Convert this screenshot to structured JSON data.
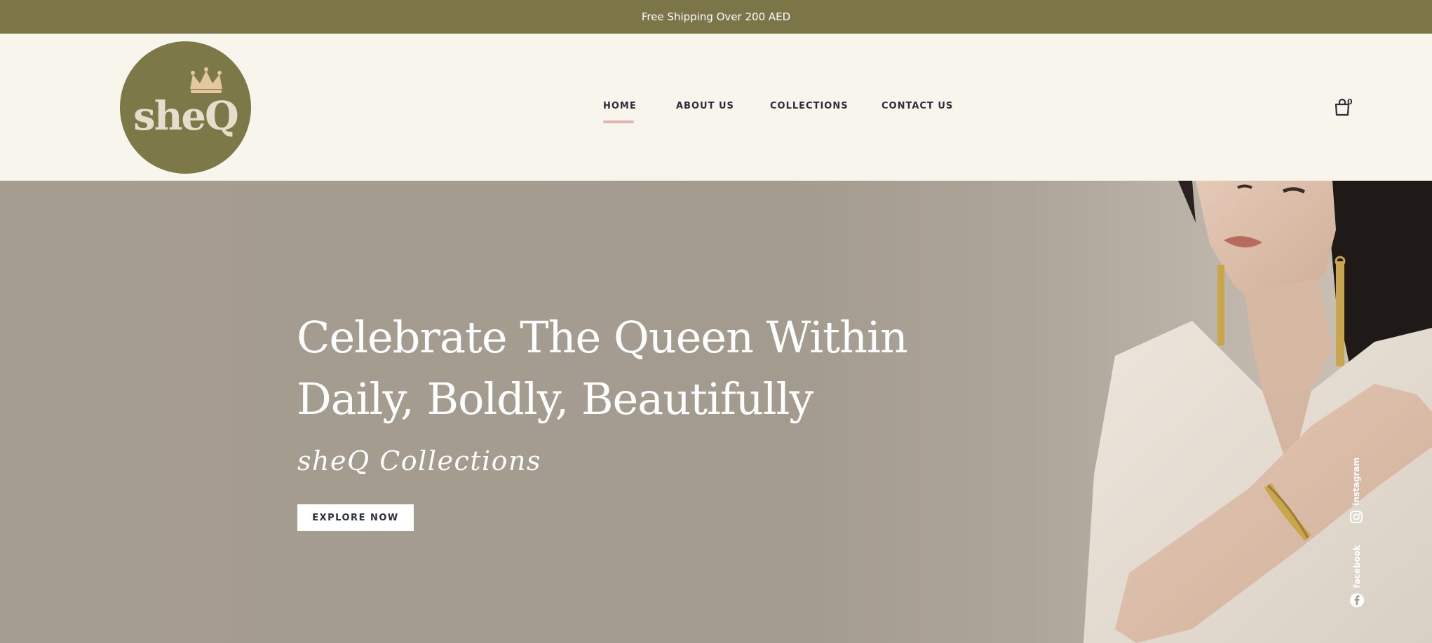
{
  "announcement": {
    "text": "Free Shipping Over 200 AED"
  },
  "logo": {
    "text": "sheQ",
    "icon": "crown-icon"
  },
  "nav": {
    "items": [
      {
        "label": "HOME",
        "active": true
      },
      {
        "label": "ABOUT US",
        "active": false
      },
      {
        "label": "COLLECTIONS",
        "active": false
      },
      {
        "label": "CONTACT US",
        "active": false
      }
    ],
    "cart_count": "0",
    "cart_icon": "shopping-bag-icon"
  },
  "hero": {
    "headline_line1": "Celebrate The Queen Within",
    "headline_line2": "Daily, Boldly, Beautifully",
    "subheading": "sheQ Collections",
    "cta_label": "EXPLORE NOW"
  },
  "social": [
    {
      "label": "instagram",
      "icon": "instagram-icon"
    },
    {
      "label": "facebook",
      "icon": "facebook-icon"
    }
  ],
  "colors": {
    "announcement_bg": "#7b7548",
    "header_bg": "#f8f5ec",
    "logo_bg": "#7d7848",
    "nav_active_underline": "#e3b5b1",
    "hero_bg": "#a69b8f"
  }
}
